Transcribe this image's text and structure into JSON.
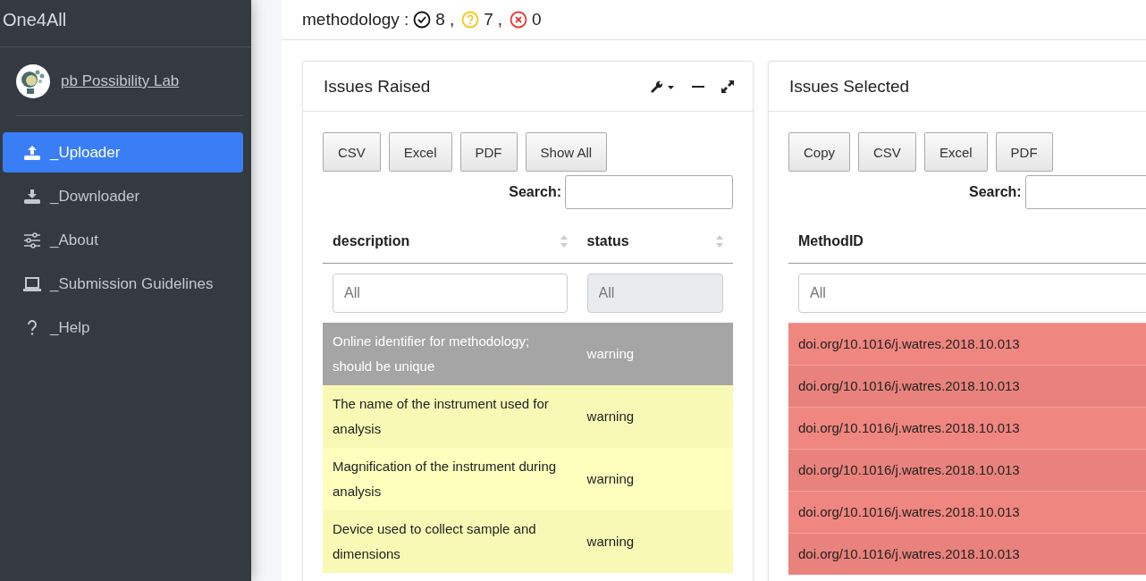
{
  "sidebar": {
    "brand": "One4All",
    "user": {
      "name": "pb Possibility Lab"
    },
    "items": [
      {
        "label": "_Uploader",
        "kind": "upload",
        "selected": true
      },
      {
        "label": "_Downloader",
        "kind": "download",
        "selected": false
      },
      {
        "label": "_About",
        "kind": "settings",
        "selected": false
      },
      {
        "label": "_Submission Guidelines",
        "kind": "guide",
        "selected": false
      },
      {
        "label": "_Help",
        "kind": "help",
        "selected": false
      }
    ]
  },
  "summary": {
    "label": "methodology :",
    "separator": ",",
    "counts": [
      {
        "kind": "ok",
        "count": "8"
      },
      {
        "kind": "unknown",
        "count": "7"
      },
      {
        "kind": "error",
        "count": "0"
      }
    ]
  },
  "panels": [
    {
      "title": "Issues Raised",
      "buttons": [
        "CSV",
        "Excel",
        "PDF",
        "Show All"
      ],
      "search_label": "Search:",
      "columns": [
        {
          "label": "description",
          "filter": {
            "placeholder": "All",
            "disabled": false
          }
        },
        {
          "label": "status",
          "filter": {
            "placeholder": "All",
            "disabled": true
          }
        }
      ],
      "rows": [
        {
          "cells": [
            "Online identifier for methodology; should be unique",
            "warning"
          ],
          "selected": true,
          "kind": "warning"
        },
        {
          "cells": [
            "The name of the instrument used for analysis",
            "warning"
          ],
          "selected": false,
          "kind": "warning"
        },
        {
          "cells": [
            "Magnification of the instrument during analysis",
            "warning"
          ],
          "selected": false,
          "kind": "warning"
        },
        {
          "cells": [
            "Device used to collect sample and dimensions",
            "warning"
          ],
          "selected": false,
          "kind": "warning"
        }
      ]
    },
    {
      "title": "Issues Selected",
      "buttons": [
        "Copy",
        "CSV",
        "Excel",
        "PDF"
      ],
      "search_label": "Search:",
      "columns": [
        {
          "label": "MethodID",
          "filter": {
            "placeholder": "All",
            "disabled": false
          }
        }
      ],
      "rows": [
        {
          "cells": [
            "doi.org/10.1016/j.watres.2018.10.013"
          ],
          "selected": false,
          "kind": "error"
        },
        {
          "cells": [
            "doi.org/10.1016/j.watres.2018.10.013"
          ],
          "selected": false,
          "kind": "error"
        },
        {
          "cells": [
            "doi.org/10.1016/j.watres.2018.10.013"
          ],
          "selected": false,
          "kind": "error"
        },
        {
          "cells": [
            "doi.org/10.1016/j.watres.2018.10.013"
          ],
          "selected": false,
          "kind": "error"
        },
        {
          "cells": [
            "doi.org/10.1016/j.watres.2018.10.013"
          ],
          "selected": false,
          "kind": "error"
        },
        {
          "cells": [
            "doi.org/10.1016/j.watres.2018.10.013"
          ],
          "selected": false,
          "kind": "error"
        }
      ]
    }
  ]
}
